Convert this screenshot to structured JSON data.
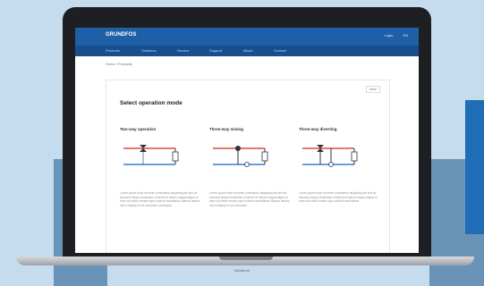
{
  "app": {
    "logo": "GRUNDFOS",
    "top_links": [
      "Login",
      "EN"
    ],
    "nav": [
      "Products",
      "Solutions",
      "Service",
      "Support",
      "About",
      "Contact"
    ],
    "breadcrumb": "Home  /  Products"
  },
  "card": {
    "top_button": "Save",
    "title": "Select operation mode",
    "columns": [
      {
        "title": "Two-way operation",
        "desc": "Lorem ipsum dolor sit amet consectetur adipiscing elit sed do eiusmod tempor incididunt ut labore et dolore magna aliqua ut enim ad minim veniam quis nostrud exercitation ullamco laboris nisi ut aliquip ex ea commodo consequat"
      },
      {
        "title": "Three-way mixing",
        "desc": "Lorem ipsum dolor sit amet consectetur adipiscing elit sed do eiusmod tempor incididunt ut labore et dolore magna aliqua ut enim ad minim veniam quis nostrud exercitation ullamco laboris nisi ut aliquip ex ea commodo"
      },
      {
        "title": "Three-way diverting",
        "desc": "Lorem ipsum dolor sit amet consectetur adipiscing elit sed do eiusmod tempor incididunt ut labore et dolore magna aliqua ut enim ad minim veniam quis nostrud exercitation"
      }
    ]
  },
  "laptop": {
    "label": "MacBook"
  },
  "colors": {
    "supply": "#e0483f",
    "return": "#3a7bd5",
    "brand": "#1f5fa7"
  },
  "icons": [
    "valve-icon",
    "pump-icon"
  ]
}
